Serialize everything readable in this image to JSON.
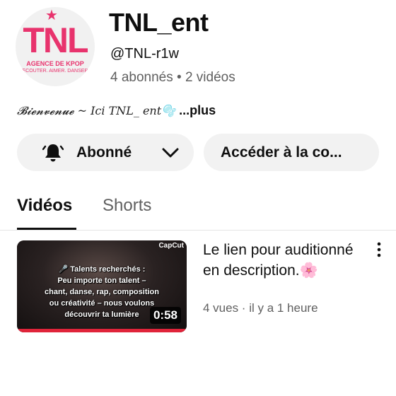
{
  "channel": {
    "logo_text": "TNL",
    "logo_subtitle": "AGENCE DE KPOP",
    "logo_tagline": "ÉCOUTER. AIMER. DANSER",
    "name": "TNL_ent",
    "handle": "@TNL-r1w",
    "stats": "4 abonnés • 2 vidéos",
    "description": "𝓑𝓲𝓮𝓷𝓿𝓮𝓷𝓾𝓮 ~ 𝐼𝑐𝑖 𝑇𝑁𝐿_ 𝑒𝑛𝑡🫧",
    "description_more": " ...plus"
  },
  "actions": {
    "subscribed_label": "Abonné",
    "access_label": "Accéder à la co..."
  },
  "tabs": [
    {
      "label": "Vidéos",
      "active": true
    },
    {
      "label": "Shorts",
      "active": false
    }
  ],
  "videos": [
    {
      "title": "Le lien pour auditionné en description.",
      "title_emoji": "🌸",
      "meta": "4 vues · il y a 1 heure",
      "duration": "0:58",
      "thumb_badge": "CapCut",
      "thumb_lines": [
        "🎤 Talents recherchés :",
        "Peu importe ton talent –",
        "chant, danse, rap, composition",
        "ou créativité – nous voulons",
        "découvrir ta lumière"
      ]
    }
  ],
  "colors": {
    "brand_pink": "#e8336d",
    "secondary_text": "#606060",
    "button_bg": "#f2f2f2",
    "progress_red": "#e0243a"
  },
  "icons": [
    "notification-bell-icon",
    "chevron-down-icon",
    "more-vert-icon"
  ]
}
